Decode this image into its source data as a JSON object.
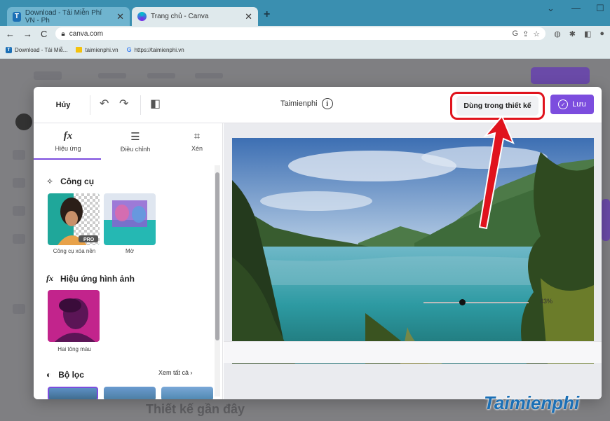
{
  "browser": {
    "tabs": [
      {
        "title": "Download - Tải Miễn Phí VN - Ph",
        "favicon": "T"
      },
      {
        "title": "Trang chủ - Canva"
      }
    ],
    "url": "canva.com",
    "bookmarks": [
      {
        "label": "Download - Tải Miễ...",
        "favicon": "T"
      },
      {
        "label": "taimienphi.vn"
      },
      {
        "label": "https://taimienphi.vn",
        "favicon": "G"
      }
    ]
  },
  "background": {
    "heading": "Thiết kế gần đây"
  },
  "editor": {
    "cancel_label": "Hủy",
    "title": "Taimienphi",
    "use_in_design_label": "Dùng trong thiết kế",
    "save_label": "Lưu",
    "tabs": [
      {
        "label": "Hiệu ứng",
        "icon": "fx-icon"
      },
      {
        "label": "Điều chỉnh",
        "icon": "sliders-icon"
      },
      {
        "label": "Xén",
        "icon": "crop-icon"
      }
    ],
    "sections": {
      "tools": {
        "title": "Công cụ",
        "items": [
          {
            "label": "Công cụ xóa nền",
            "badge": "PRO"
          },
          {
            "label": "Mờ"
          }
        ]
      },
      "image_effects": {
        "title": "Hiệu ứng hình ảnh",
        "items": [
          {
            "label": "Hai tông màu"
          }
        ]
      },
      "filters": {
        "title": "Bộ lọc",
        "see_all": "Xem tất cả"
      }
    },
    "zoom": {
      "value": "43%",
      "level": 43
    }
  },
  "watermark": "Taimienphi",
  "colors": {
    "accent": "#7c4dde",
    "highlight": "#e0131d",
    "tab_bar": "#3a8fb0"
  }
}
